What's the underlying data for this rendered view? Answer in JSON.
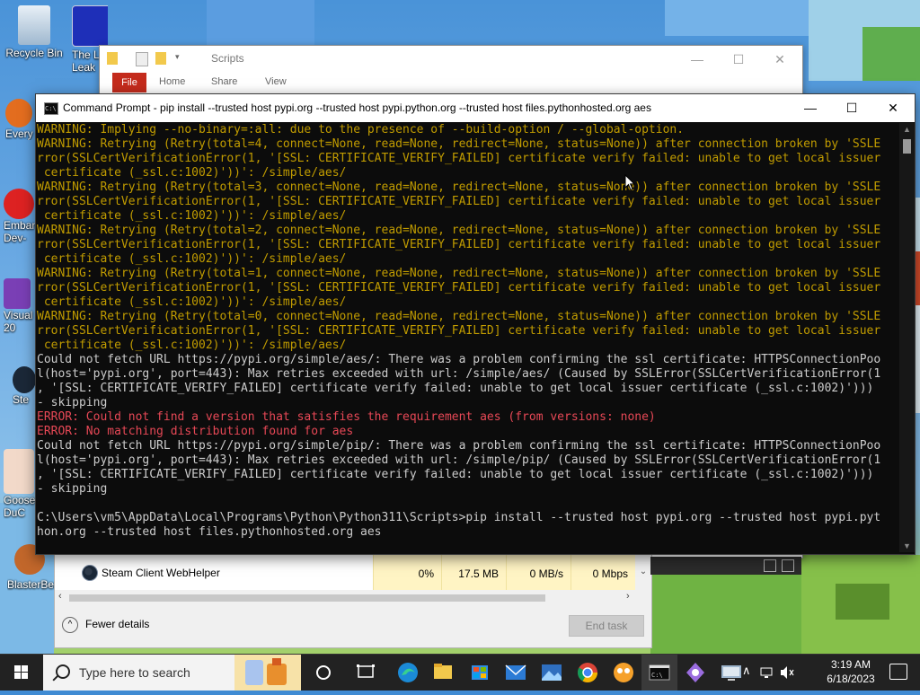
{
  "desktop": {
    "icons": [
      {
        "label": "Recycle Bin"
      },
      {
        "label": "The L Leak"
      },
      {
        "label": "Every"
      },
      {
        "label": "Embar Dev-"
      },
      {
        "label": "Visual 20"
      },
      {
        "label": "Ste"
      },
      {
        "label": "Goose DuC"
      },
      {
        "label": "BlasterBea"
      }
    ]
  },
  "explorer": {
    "title": "Scripts",
    "ribbon": {
      "file": "File",
      "home": "Home",
      "share": "Share",
      "view": "View"
    },
    "controls": {
      "minimize": "—",
      "maximize": "☐",
      "close": "✕"
    }
  },
  "cmd": {
    "title": "Command Prompt - pip  install --trusted host pypi.org --trusted host pypi.python.org --trusted host files.pythonhosted.org aes",
    "icon_text": "C:\\",
    "controls": {
      "minimize": "—",
      "maximize": "☐",
      "close": "✕"
    },
    "lines": [
      {
        "t": "warn",
        "text": "WARNING: Implying --no-binary=:all: due to the presence of --build-option / --global-option."
      },
      {
        "t": "warn",
        "text": "WARNING: Retrying (Retry(total=4, connect=None, read=None, redirect=None, status=None)) after connection broken by 'SSLE"
      },
      {
        "t": "warn",
        "text": "rror(SSLCertVerificationError(1, '[SSL: CERTIFICATE_VERIFY_FAILED] certificate verify failed: unable to get local issuer"
      },
      {
        "t": "warn",
        "text": " certificate (_ssl.c:1002)'))': /simple/aes/"
      },
      {
        "t": "warn",
        "text": "WARNING: Retrying (Retry(total=3, connect=None, read=None, redirect=None, status=None)) after connection broken by 'SSLE"
      },
      {
        "t": "warn",
        "text": "rror(SSLCertVerificationError(1, '[SSL: CERTIFICATE_VERIFY_FAILED] certificate verify failed: unable to get local issuer"
      },
      {
        "t": "warn",
        "text": " certificate (_ssl.c:1002)'))': /simple/aes/"
      },
      {
        "t": "warn",
        "text": "WARNING: Retrying (Retry(total=2, connect=None, read=None, redirect=None, status=None)) after connection broken by 'SSLE"
      },
      {
        "t": "warn",
        "text": "rror(SSLCertVerificationError(1, '[SSL: CERTIFICATE_VERIFY_FAILED] certificate verify failed: unable to get local issuer"
      },
      {
        "t": "warn",
        "text": " certificate (_ssl.c:1002)'))': /simple/aes/"
      },
      {
        "t": "warn",
        "text": "WARNING: Retrying (Retry(total=1, connect=None, read=None, redirect=None, status=None)) after connection broken by 'SSLE"
      },
      {
        "t": "warn",
        "text": "rror(SSLCertVerificationError(1, '[SSL: CERTIFICATE_VERIFY_FAILED] certificate verify failed: unable to get local issuer"
      },
      {
        "t": "warn",
        "text": " certificate (_ssl.c:1002)'))': /simple/aes/"
      },
      {
        "t": "warn",
        "text": "WARNING: Retrying (Retry(total=0, connect=None, read=None, redirect=None, status=None)) after connection broken by 'SSLE"
      },
      {
        "t": "warn",
        "text": "rror(SSLCertVerificationError(1, '[SSL: CERTIFICATE_VERIFY_FAILED] certificate verify failed: unable to get local issuer"
      },
      {
        "t": "warn",
        "text": " certificate (_ssl.c:1002)'))': /simple/aes/"
      },
      {
        "t": "norm",
        "text": "Could not fetch URL https://pypi.org/simple/aes/: There was a problem confirming the ssl certificate: HTTPSConnectionPoo"
      },
      {
        "t": "norm",
        "text": "l(host='pypi.org', port=443): Max retries exceeded with url: /simple/aes/ (Caused by SSLError(SSLCertVerificationError(1"
      },
      {
        "t": "norm",
        "text": ", '[SSL: CERTIFICATE_VERIFY_FAILED] certificate verify failed: unable to get local issuer certificate (_ssl.c:1002)')))"
      },
      {
        "t": "norm",
        "text": "- skipping"
      },
      {
        "t": "err",
        "text": "ERROR: Could not find a version that satisfies the requirement aes (from versions: none)"
      },
      {
        "t": "err",
        "text": "ERROR: No matching distribution found for aes"
      },
      {
        "t": "norm",
        "text": "Could not fetch URL https://pypi.org/simple/pip/: There was a problem confirming the ssl certificate: HTTPSConnectionPoo"
      },
      {
        "t": "norm",
        "text": "l(host='pypi.org', port=443): Max retries exceeded with url: /simple/pip/ (Caused by SSLError(SSLCertVerificationError(1"
      },
      {
        "t": "norm",
        "text": ", '[SSL: CERTIFICATE_VERIFY_FAILED] certificate verify failed: unable to get local issuer certificate (_ssl.c:1002)')))"
      },
      {
        "t": "norm",
        "text": "- skipping"
      },
      {
        "t": "norm",
        "text": ""
      },
      {
        "t": "norm",
        "text": "C:\\Users\\vm5\\AppData\\Local\\Programs\\Python\\Python311\\Scripts>pip install --trusted host pypi.org --trusted host pypi.pyt"
      },
      {
        "t": "norm",
        "text": "hon.org --trusted host files.pythonhosted.org aes"
      }
    ],
    "colors": {
      "warn": "#c19c00",
      "err": "#e74856",
      "norm": "#cccccc"
    }
  },
  "taskmgr": {
    "row": {
      "name": "Steam Client WebHelper",
      "cpu": "0%",
      "memory": "17.5 MB",
      "disk": "0 MB/s",
      "network": "0 Mbps"
    },
    "fewer_details": "Fewer details",
    "fewer_icon": "^",
    "end_task": "End task"
  },
  "taskbar": {
    "search_placeholder": "Type here to search",
    "clock_time": "3:19 AM",
    "clock_date": "6/18/2023",
    "apps": [
      "task-view",
      "widgets",
      "edge",
      "file-explorer",
      "microsoft-store",
      "mail",
      "photos",
      "chrome",
      "scratch",
      "command-prompt",
      "app",
      "network-settings"
    ]
  }
}
